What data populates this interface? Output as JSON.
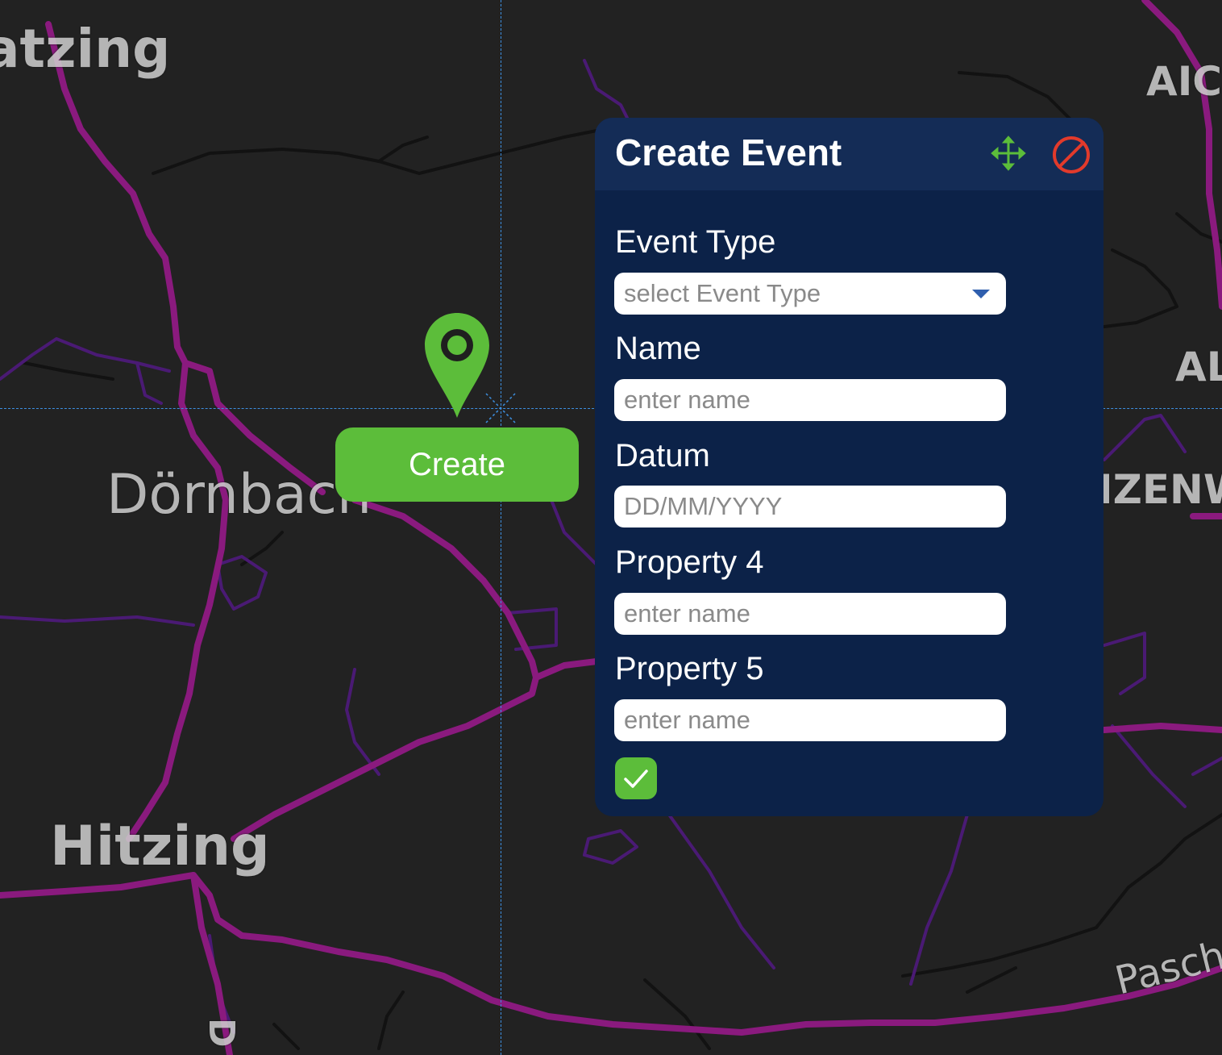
{
  "map": {
    "labels": [
      {
        "text": "atzing"
      },
      {
        "text": "AIC"
      },
      {
        "text": "AL"
      },
      {
        "text": "Dörnbach"
      },
      {
        "text": "IZENW"
      },
      {
        "text": "Hitzing"
      },
      {
        "text": "Pasch"
      },
      {
        "text": "D"
      }
    ]
  },
  "marker": {
    "create_label": "Create",
    "pin_color": "#5cbd3a"
  },
  "panel": {
    "title": "Create Event",
    "move_icon": "move-arrows-icon",
    "close_icon": "cancel-circle-icon",
    "fields": {
      "event_type": {
        "label": "Event Type",
        "placeholder": "select Event Type"
      },
      "name": {
        "label": "Name",
        "placeholder": "enter name"
      },
      "datum": {
        "label": "Datum",
        "placeholder": "DD/MM/YYYY"
      },
      "property4": {
        "label": "Property 4",
        "placeholder": "enter name"
      },
      "property5": {
        "label": "Property 5",
        "placeholder": "enter name"
      }
    },
    "confirm_icon": "checkmark-icon"
  },
  "colors": {
    "accent_green": "#5cbd3a",
    "panel_bg": "#0c2248",
    "header_bg": "#142c56",
    "cancel_red": "#e23a2b",
    "road_magenta": "#8a1a7e",
    "crosshair_blue": "#3d8fe0"
  }
}
